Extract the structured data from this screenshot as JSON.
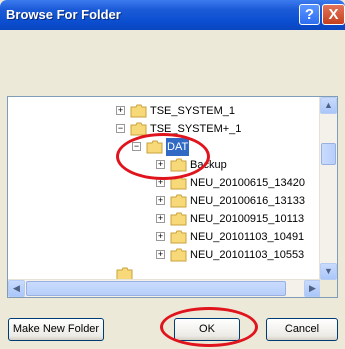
{
  "window": {
    "title": "Browse For Folder"
  },
  "titlebar": {
    "help": "?",
    "close": "X"
  },
  "tree": {
    "items": [
      {
        "label": "TSE_SYSTEM_1",
        "expander": "+"
      },
      {
        "label": "TSE_SYSTEM+_1",
        "expander": "−"
      },
      {
        "label": "DAT",
        "expander": "−",
        "selected": true
      },
      {
        "label": "Backup",
        "expander": "+"
      },
      {
        "label": "NEU_20100615_13420",
        "expander": "+"
      },
      {
        "label": "NEU_20100616_13133",
        "expander": "+"
      },
      {
        "label": "NEU_20100915_10113",
        "expander": "+"
      },
      {
        "label": "NEU_20101103_10491",
        "expander": "+"
      },
      {
        "label": "NEU_20101103_10553",
        "expander": "+"
      }
    ]
  },
  "buttons": {
    "make_new_folder": "Make New Folder",
    "ok": "OK",
    "cancel": "Cancel"
  },
  "scroll": {
    "up": "▲",
    "down": "▼",
    "left": "◀",
    "right": "▶"
  },
  "colors": {
    "title_blue": "#0b4fd0",
    "selection": "#316ac5",
    "annotation_red": "#e0141c"
  }
}
